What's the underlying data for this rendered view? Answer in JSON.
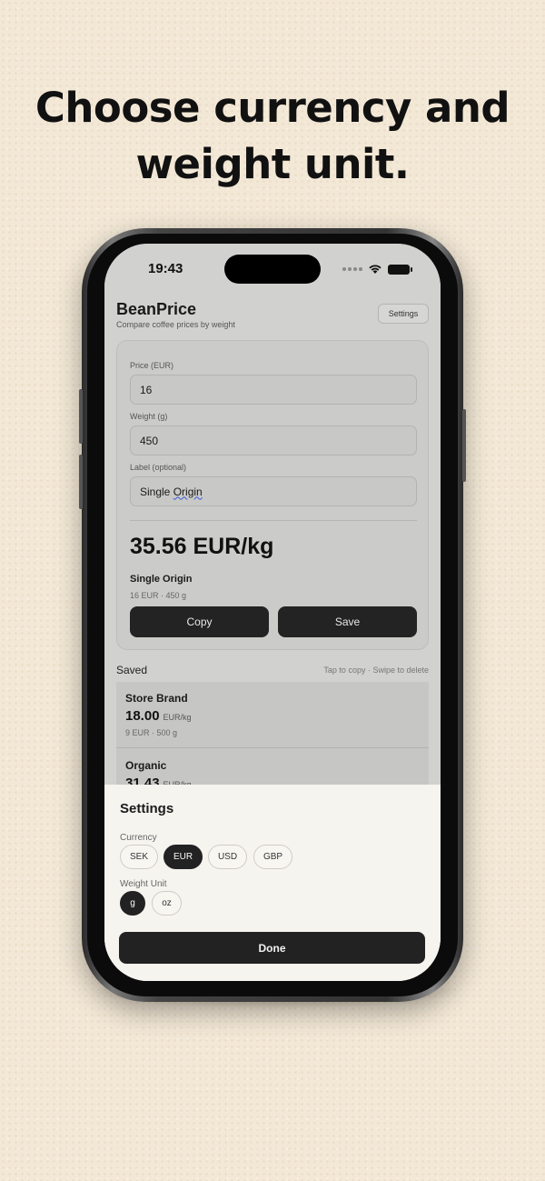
{
  "headline": {
    "line1": "Choose currency and",
    "line2": "weight unit."
  },
  "status": {
    "time": "19:43"
  },
  "app": {
    "title": "BeanPrice",
    "subtitle": "Compare coffee prices by weight",
    "settings_label": "Settings"
  },
  "form": {
    "price_label": "Price (EUR)",
    "price_value": "16",
    "weight_label": "Weight (g)",
    "weight_value": "450",
    "label_label": "Label (optional)",
    "label_value_part1": "Single ",
    "label_value_part2": "Origin"
  },
  "result": {
    "value": "35.56 EUR/kg",
    "label": "Single Origin",
    "meta": "16 EUR · 450 g"
  },
  "actions": {
    "copy_label": "Copy",
    "save_label": "Save"
  },
  "saved": {
    "title": "Saved",
    "hint": "Tap to copy · Swipe to delete",
    "items": [
      {
        "name": "Store Brand",
        "price": "18.00",
        "unit": "EUR/kg",
        "meta": "9 EUR · 500 g"
      },
      {
        "name": "Organic",
        "price": "31.43",
        "unit": "EUR/kg",
        "meta": ""
      }
    ]
  },
  "sheet": {
    "title": "Settings",
    "currency_label": "Currency",
    "currencies": [
      "SEK",
      "EUR",
      "USD",
      "GBP"
    ],
    "selected_currency": "EUR",
    "weight_label": "Weight Unit",
    "units": [
      "g",
      "oz"
    ],
    "selected_unit": "g",
    "done_label": "Done"
  }
}
